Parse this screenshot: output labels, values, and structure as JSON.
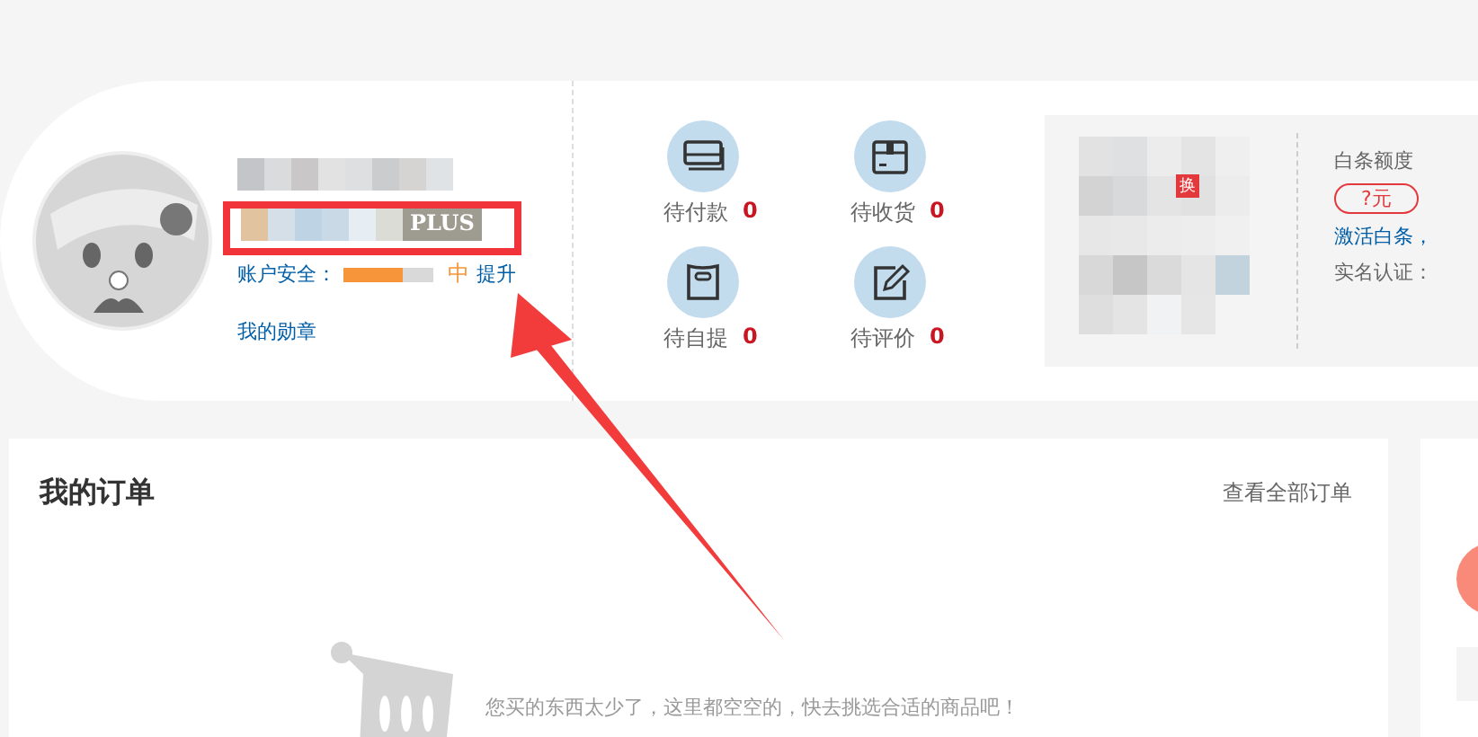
{
  "user": {
    "badge": "PLUS",
    "security_label": "账户安全：",
    "level": 0.65,
    "security_level_text": "中",
    "upgrade_link": "提升",
    "medals_link": "我的勋章"
  },
  "order_status": [
    {
      "label": "待付款",
      "count": "0",
      "kind": "card"
    },
    {
      "label": "待收货",
      "count": "0",
      "kind": "box"
    },
    {
      "label": "待自提",
      "count": "0",
      "kind": "bag"
    },
    {
      "label": "待评价",
      "count": "0",
      "kind": "edit"
    }
  ],
  "baitiao": {
    "badge": "换",
    "title": "白条额度",
    "amount": "?元",
    "activate": "激活白条，",
    "realname": "实名认证："
  },
  "orders": {
    "title": "我的订单",
    "view_all": "查看全部订单",
    "empty_message": "您买的东西太少了，这里都空空的，快去挑选合适的商品吧！"
  }
}
